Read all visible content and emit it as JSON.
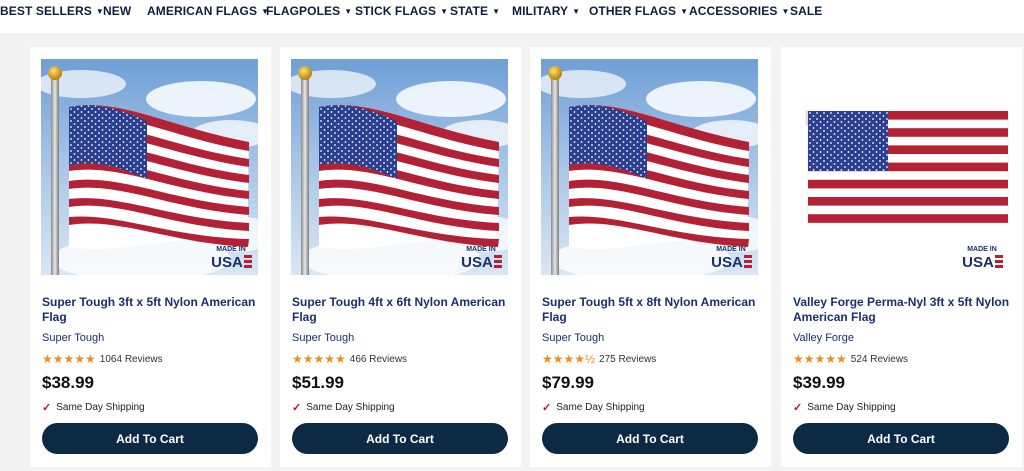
{
  "nav": {
    "items": [
      {
        "label": "BEST SELLERS",
        "dropdown": true
      },
      {
        "label": "NEW",
        "dropdown": false
      },
      {
        "label": "AMERICAN FLAGS",
        "dropdown": true
      },
      {
        "label": "FLAGPOLES",
        "dropdown": true
      },
      {
        "label": "STICK FLAGS",
        "dropdown": true
      },
      {
        "label": "STATE",
        "dropdown": true
      },
      {
        "label": "MILITARY",
        "dropdown": true
      },
      {
        "label": "OTHER FLAGS",
        "dropdown": true
      },
      {
        "label": "ACCESSORIES",
        "dropdown": true
      },
      {
        "label": "SALE",
        "dropdown": false
      }
    ],
    "caret": "▼"
  },
  "badge": {
    "line1": "MADE IN",
    "line2": "USA"
  },
  "products": [
    {
      "title": "Super Tough 3ft x 5ft Nylon American Flag",
      "brand": "Super Tough",
      "stars": "★★★★★",
      "rating": 5,
      "reviews": "1064 Reviews",
      "price": "$38.99",
      "shipping": "Same Day Shipping",
      "cart": "Add To Cart",
      "image": "flag-on-pole-sky"
    },
    {
      "title": "Super Tough 4ft x 6ft Nylon American Flag",
      "brand": "Super Tough",
      "stars": "★★★★★",
      "rating": 5,
      "reviews": "466 Reviews",
      "price": "$51.99",
      "shipping": "Same Day Shipping",
      "cart": "Add To Cart",
      "image": "flag-on-pole-sky"
    },
    {
      "title": "Super Tough 5ft x 8ft Nylon American Flag",
      "brand": "Super Tough",
      "stars": "★★★★½",
      "rating": 4.5,
      "reviews": "275 Reviews",
      "price": "$79.99",
      "shipping": "Same Day Shipping",
      "cart": "Add To Cart",
      "image": "flag-on-pole-sky"
    },
    {
      "title": "Valley Forge Perma-Nyl 3ft x 5ft Nylon American Flag",
      "brand": "Valley Forge",
      "stars": "★★★★★",
      "rating": 5,
      "reviews": "524 Reviews",
      "price": "$39.99",
      "shipping": "Same Day Shipping",
      "cart": "Add To Cart",
      "image": "flat-flag-white"
    }
  ],
  "colors": {
    "nav_text": "#0f1e3c",
    "button_bg": "#0d2a45",
    "star": "#f08c1b",
    "check": "#c8102e",
    "flag_red": "#b22234",
    "flag_blue": "#2a3f8f"
  },
  "icons": {
    "check": "✓"
  }
}
